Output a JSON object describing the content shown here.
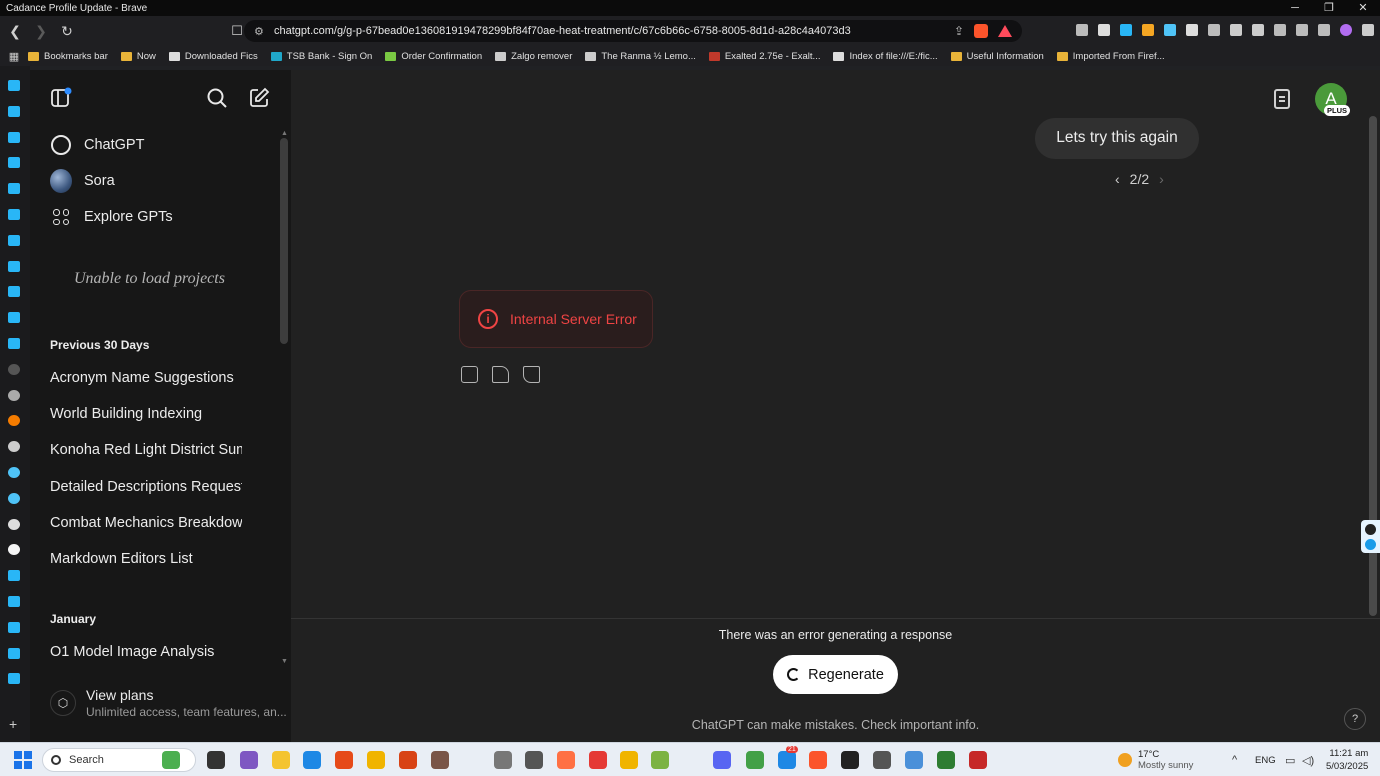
{
  "window": {
    "title": "Cadance Profile Update - Brave",
    "minimize": "─",
    "maximize": "❐",
    "close": "✕"
  },
  "toolbar": {
    "back": "❮",
    "forward": "❯",
    "reload": "↻",
    "bookmark_page": "☐",
    "url": "chatgpt.com/g/g-p-67bead0e136081919478299bf84f70ae-heat-treatment/c/67c6b66c-6758-8005-8d1d-a28c4a4073d3",
    "tune": "⚙",
    "share": "⇪"
  },
  "bookmarks": [
    {
      "label": "Bookmarks bar",
      "icon": "folder-icon",
      "color": "#e8b339"
    },
    {
      "label": "Now",
      "icon": "folder-icon",
      "color": "#e8b339"
    },
    {
      "label": "Downloaded Fics",
      "icon": "page-icon",
      "color": "#dddddd"
    },
    {
      "label": "TSB Bank - Sign On",
      "icon": "tsb-icon",
      "color": "#20a7c9"
    },
    {
      "label": "Order Confirmation",
      "icon": "order-icon",
      "color": "#7ac943"
    },
    {
      "label": "Zalgo remover",
      "icon": "globe-icon",
      "color": "#cccccc"
    },
    {
      "label": "The Ranma ½ Lemo...",
      "icon": "globe-icon",
      "color": "#cccccc"
    },
    {
      "label": "Exalted 2.75e - Exalt...",
      "icon": "exalted-icon",
      "color": "#c0392b"
    },
    {
      "label": "Index of file:///E:/fic...",
      "icon": "page-icon",
      "color": "#dddddd"
    },
    {
      "label": "Useful Information",
      "icon": "folder-icon",
      "color": "#e8b339"
    },
    {
      "label": "Imported From Firef...",
      "icon": "folder-icon",
      "color": "#e8b339"
    }
  ],
  "sidebar": {
    "toggle_icon": "sidebar-toggle-icon",
    "search_icon": "search-icon",
    "new_chat_icon": "new-chat-icon",
    "nav": [
      {
        "label": "ChatGPT",
        "icon": "chatgpt-logo-icon"
      },
      {
        "label": "Sora",
        "icon": "sora-orb-icon"
      },
      {
        "label": "Explore GPTs",
        "icon": "explore-grid-icon"
      }
    ],
    "projects_status": "Unable to load projects",
    "sections": [
      {
        "heading": "Previous 30 Days",
        "items": [
          "Acronym Name Suggestions",
          "World Building Indexing",
          "Konoha Red Light District Summary",
          "Detailed Descriptions Request",
          "Combat Mechanics Breakdown",
          "Markdown Editors List"
        ]
      },
      {
        "heading": "January",
        "items": [
          "O1 Model Image Analysis"
        ]
      }
    ],
    "view_plans": {
      "title": "View plans",
      "subtitle": "Unlimited access, team features, an..."
    }
  },
  "main": {
    "avatar_letter": "A",
    "plan_badge": "PLUS",
    "user_message": "Lets try this again",
    "pager": {
      "prev": "‹",
      "current": "2/2",
      "next": "›"
    },
    "error": {
      "icon": "i",
      "text": "Internal Server Error",
      "color": "#ef4444"
    },
    "generation_error": "There was an error generating a response",
    "regenerate_label": "Regenerate",
    "footnote": "ChatGPT can make mistakes. Check important info.",
    "help": "?"
  },
  "taskbar": {
    "search_placeholder": "Search",
    "weather_temp": "17°C",
    "weather_desc": "Mostly sunny",
    "language": "ENG",
    "time": "11:21 am",
    "date": "5/03/2025",
    "chevron": "^",
    "badge_count": "21"
  },
  "colors": {
    "sidebar_bg": "#171717",
    "main_bg": "#212121",
    "error_red": "#ef4444",
    "avatar_green": "#4a9a3a"
  }
}
